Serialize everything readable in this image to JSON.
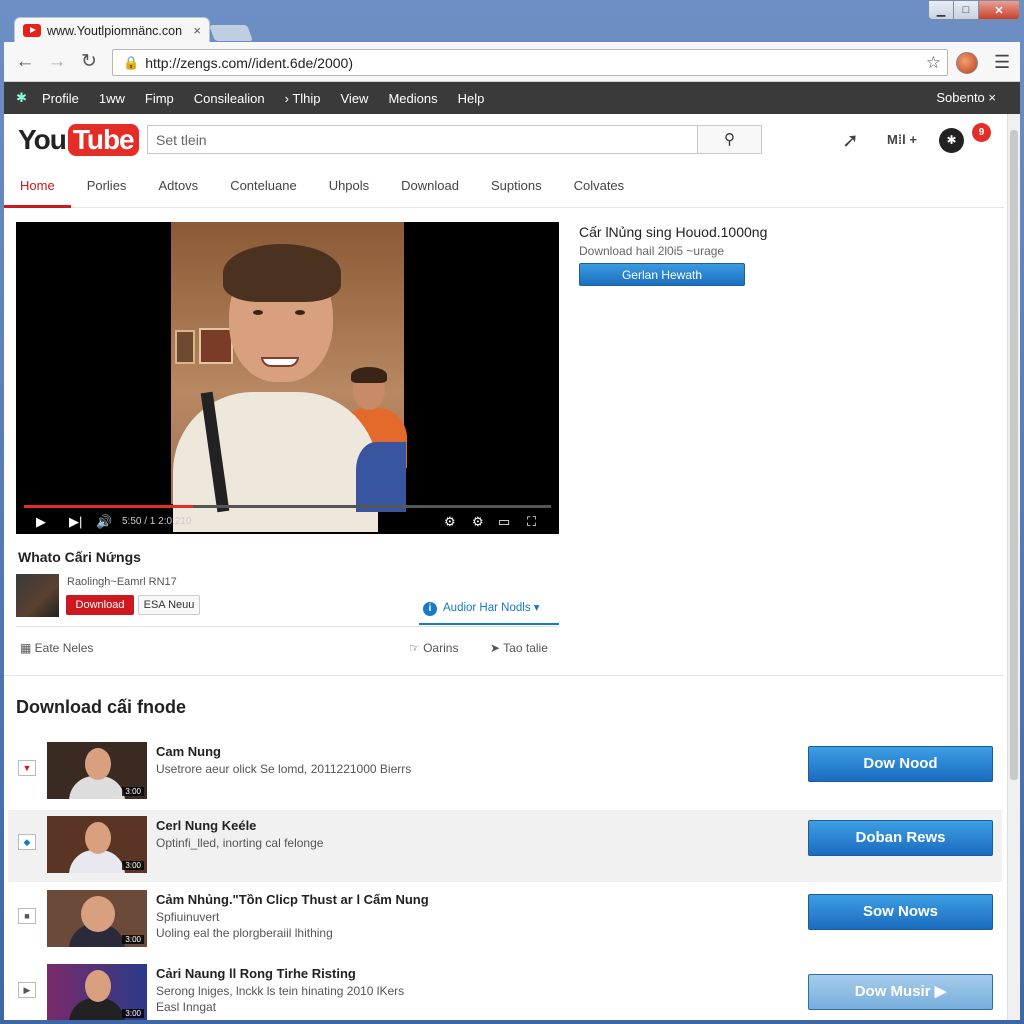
{
  "browser": {
    "tab_title": "www.Youtlpiomnänc.con",
    "tab_close": "×",
    "url": "http://zengs.com//ident.6de/2000)",
    "window_controls": {
      "minimize": "▁",
      "maximize": "□",
      "close": "✕"
    }
  },
  "bookmarks": {
    "items": [
      "Profile",
      "1ww",
      "Fimp",
      "Consilealion",
      "Tlhip",
      "View",
      "Medions",
      "Help"
    ],
    "right_label": "Sobento ×"
  },
  "header": {
    "logo_you": "You",
    "logo_tube": "Tube",
    "search_placeholder": "Set tlein",
    "apps_label": "M⁞l +",
    "badge_count": "9"
  },
  "nav_tabs": [
    "Home",
    "Porlies",
    "Adtovs",
    "Conteluane",
    "Uhpols",
    "Download",
    "Suptions",
    "Colvates"
  ],
  "player": {
    "time": "5:50 / 1 2:0:210",
    "progress": 0.32
  },
  "side": {
    "title": "Cấr lNủng sing Houod.1000ng",
    "subtitle": "Download hail 2l0i5 ~urage",
    "button": "Gerlan Hewath"
  },
  "video": {
    "title": "Whato Cấri Nứngs",
    "channel": "Raolingh~Eamrl RN17",
    "download_button": "Download",
    "esa_button": "ESA Neuu",
    "audio_link": "Audior Har Nodls",
    "action_left": "Eate Neles",
    "action_mid": "Oarins",
    "action_right": "Tao talie"
  },
  "download_section": {
    "heading": "Download cấi fnode",
    "rows": [
      {
        "title": "Cam Nung",
        "desc": "Usetrore aeur olick Se lomd, 2011221000 Bierrs",
        "desc2": "",
        "button": "Dow Nood",
        "duration": "3:00"
      },
      {
        "title": "Cerl Nung Keéle",
        "desc": "Optinfi_lled, inorting cal felonge",
        "desc2": "",
        "button": "Doban Rews",
        "duration": "3:00"
      },
      {
        "title": "Cảm Nhủng.\"Tồn Clicp Thust ar l Cấm Nung",
        "desc": "Spfiuinuvert",
        "desc2": "Uoling eal the plorgberaiil lhithing",
        "button": "Sow Nows",
        "duration": "3:00"
      },
      {
        "title": "Cảri Naung ll Rong Tirhe Risting",
        "desc": "Serong lniges, lnckk ls tein hinating 2010 lKers",
        "desc2": "Easl Inngat",
        "button": "Dow Musir",
        "duration": "3:00"
      }
    ]
  }
}
